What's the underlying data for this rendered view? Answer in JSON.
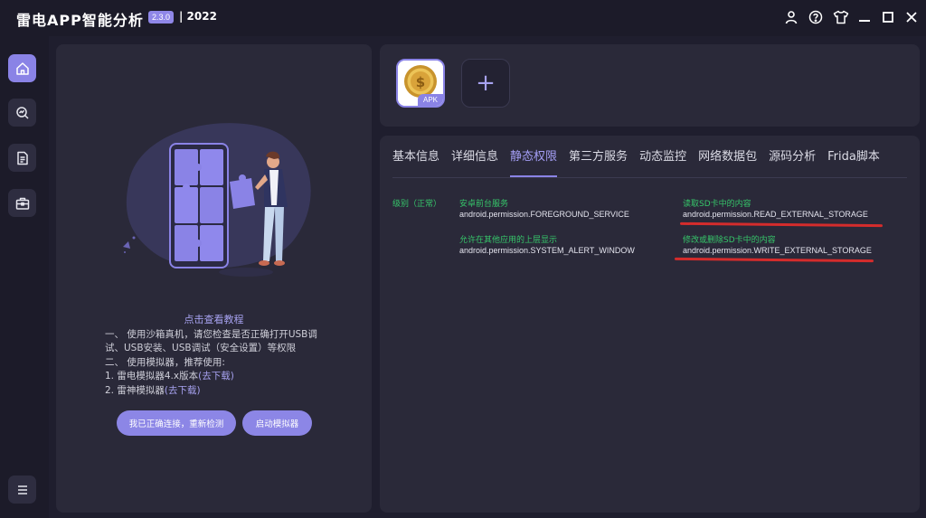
{
  "header": {
    "title": "雷电APP智能分析",
    "version": "2.3.0",
    "year": "| 2022",
    "icons": [
      "user-icon",
      "help-icon",
      "shirt-icon",
      "minimize-icon",
      "maximize-icon",
      "close-icon"
    ]
  },
  "sidebar": {
    "items": [
      {
        "icon": "home-icon",
        "active": true
      },
      {
        "icon": "analysis-icon",
        "active": false
      },
      {
        "icon": "document-icon",
        "active": false
      },
      {
        "icon": "toolbox-icon",
        "active": false
      },
      {
        "icon": "menu-icon",
        "active": false
      }
    ]
  },
  "tutorial": {
    "title": "点击查看教程",
    "line1": "一、 使用沙箱真机，请您检查是否正确打开USB调",
    "line2": "试、USB安装、USB调试（安全设置）等权限",
    "line3": "二、 使用模拟器，推荐使用:",
    "line4_prefix": "1. 雷电模拟器4.x版本",
    "line4_link": "(去下载)",
    "line5_prefix": "2. 雷神模拟器",
    "line5_link": "(去下载)"
  },
  "buttons": {
    "reconnect": "我已正确连接，重新检测",
    "start_emulator": "启动模拟器"
  },
  "app": {
    "badge": "APK",
    "add_symbol": "+"
  },
  "tabs": [
    {
      "label": "基本信息",
      "active": false
    },
    {
      "label": "详细信息",
      "active": false
    },
    {
      "label": "静态权限",
      "active": true
    },
    {
      "label": "第三方服务",
      "active": false
    },
    {
      "label": "动态监控",
      "active": false
    },
    {
      "label": "网络数据包",
      "active": false
    },
    {
      "label": "源码分析",
      "active": false
    },
    {
      "label": "Frida脚本",
      "active": false
    }
  ],
  "permissions": {
    "level": "级别（正常）",
    "items": [
      {
        "label": "安卓前台服务",
        "name": "android.permission.FOREGROUND_SERVICE"
      },
      {
        "label": "允许在其他应用的上层显示",
        "name": "android.permission.SYSTEM_ALERT_WINDOW"
      },
      {
        "label": "读取SD卡中的内容",
        "name": "android.permission.READ_EXTERNAL_STORAGE"
      },
      {
        "label": "修改或删除SD卡中的内容",
        "name": "android.permission.WRITE_EXTERNAL_STORAGE"
      }
    ]
  },
  "colors": {
    "accent": "#8a83e6",
    "accent_text": "#a49ef5",
    "background": "#1f1e2e",
    "panel": "#2a2939",
    "green": "#36c66a",
    "annotation_red": "#d42c2c"
  }
}
